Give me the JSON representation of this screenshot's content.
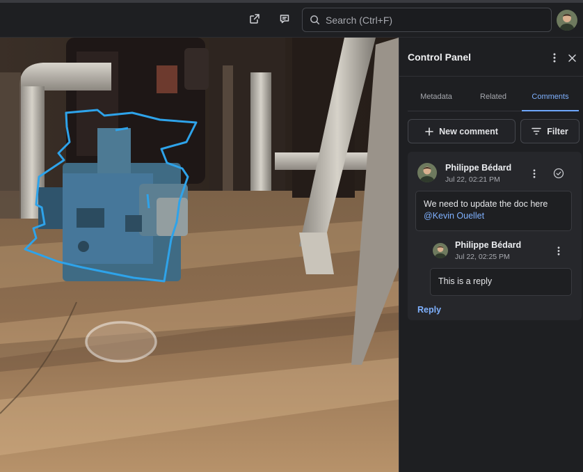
{
  "topbar": {
    "icons": [
      "open-external-icon",
      "comment-icon"
    ],
    "search_placeholder": "Search (Ctrl+F)",
    "search_value": ""
  },
  "panel": {
    "title": "Control Panel",
    "tabs": [
      {
        "label": "Metadata",
        "active": false
      },
      {
        "label": "Related",
        "active": false
      },
      {
        "label": "Comments",
        "active": true
      }
    ],
    "new_comment_label": "New comment",
    "filter_label": "Filter"
  },
  "thread": {
    "comment": {
      "author": "Philippe Bédard",
      "time": "Jul 22, 02:21 PM",
      "text": "We need to update the doc here",
      "mention": "@Kevin Ouellet"
    },
    "reply": {
      "author": "Philippe Bédard",
      "time": "Jul 22, 02:25 PM",
      "text": "This is a reply"
    },
    "reply_label": "Reply"
  },
  "colors": {
    "accent": "#7fb1ff",
    "selection_outline": "#2ea3ea",
    "panel_bg": "#1e1f22"
  }
}
